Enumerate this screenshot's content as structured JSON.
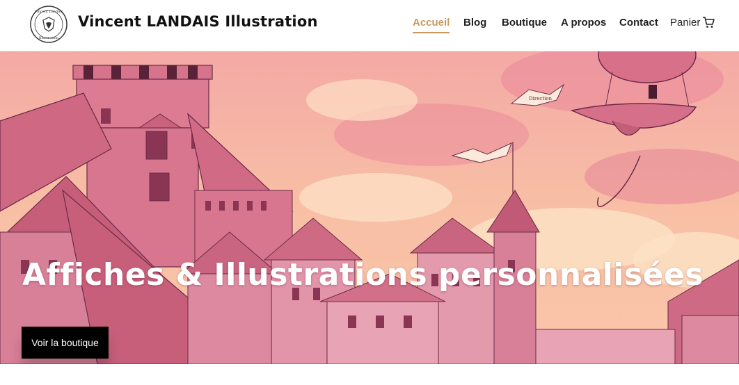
{
  "brand": {
    "title": "Vincent LANDAIS Illustration",
    "badge_text_top": "Vincent Landais",
    "badge_text_bottom": "Illustration"
  },
  "nav": {
    "items": [
      {
        "label": "Accueil",
        "active": true
      },
      {
        "label": "Blog",
        "active": false
      },
      {
        "label": "Boutique",
        "active": false
      },
      {
        "label": "A propos",
        "active": false
      },
      {
        "label": "Contact",
        "active": false
      }
    ],
    "cart_label": "Panier",
    "cart_icon": "cart-icon"
  },
  "hero": {
    "heading": "Affiches & Illustrations personnalisées",
    "button_label": "Voir la boutique",
    "banner_text": "Direction"
  },
  "colors": {
    "accent": "#c89a5e",
    "hero_pink": "#d9708a",
    "hero_peach": "#f6b79a",
    "button": "#000000"
  }
}
